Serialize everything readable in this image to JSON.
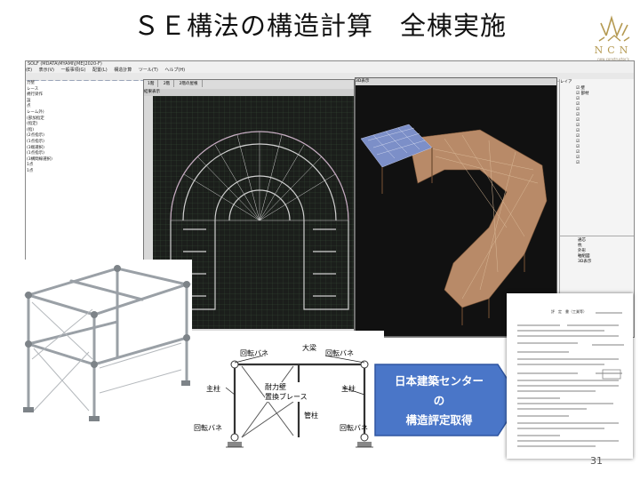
{
  "slide": {
    "title": "ＳＥ構法の構造計算　全棟実施",
    "page_number": "31"
  },
  "logo": {
    "text": "NCN",
    "sub": "new constructor's network",
    "color": "#b59a52"
  },
  "software": {
    "title": "SOLF (MDATA\\MYAMI\\[ME]2020-F)",
    "menu": [
      "(E)",
      "表示(V)",
      "一般事項(G)",
      "配置(L)",
      "構造計算",
      "ツール(T)",
      "ヘルプ(H)"
    ],
    "tree_items": [
      "",
      "力壁",
      "レース",
      "規行梁作",
      "",
      "",
      "",
      "設",
      "",
      "",
      "",
      "",
      "",
      "",
      "点",
      "",
      "",
      "",
      "",
      "",
      "レーム外)",
      "",
      "(部加指定",
      "",
      "",
      "(指定)",
      "(指)",
      "",
      "",
      "",
      "(2点指示)",
      "(1点指示)",
      "(3端選択)",
      "(1点指示)",
      "(3構間線選択)",
      "1点",
      "1点"
    ],
    "plan_tabs": [
      "1階",
      "2階",
      "2階の屋根"
    ],
    "plan_sub": "結果表示",
    "v3d_tab": "3D表示",
    "panel_title": "レイア",
    "panel_items": [
      "壁",
      "部材",
      "",
      "",
      "",
      "",
      "",
      "",
      "",
      "",
      "",
      "",
      "",
      "",
      ""
    ],
    "panel_bottom": [
      "通芯",
      "杭",
      "外形",
      "軸組図",
      "3D表示"
    ]
  },
  "diagram": {
    "labels": {
      "top_beam": "大梁",
      "hinge_tl": "回転バネ",
      "hinge_tr": "回転バネ",
      "col_l": "主柱",
      "col_r": "主柱",
      "brace": "耐力壁\n置換ブレース",
      "tube": "管柱",
      "hinge_bl": "回転バネ",
      "hinge_br": "回転バネ"
    }
  },
  "callout": {
    "lines": [
      "日本建築センター",
      "の",
      "構造評定取得"
    ],
    "color": "#4a76c8"
  },
  "document": {
    "title": "評　定　書（工業等）"
  }
}
